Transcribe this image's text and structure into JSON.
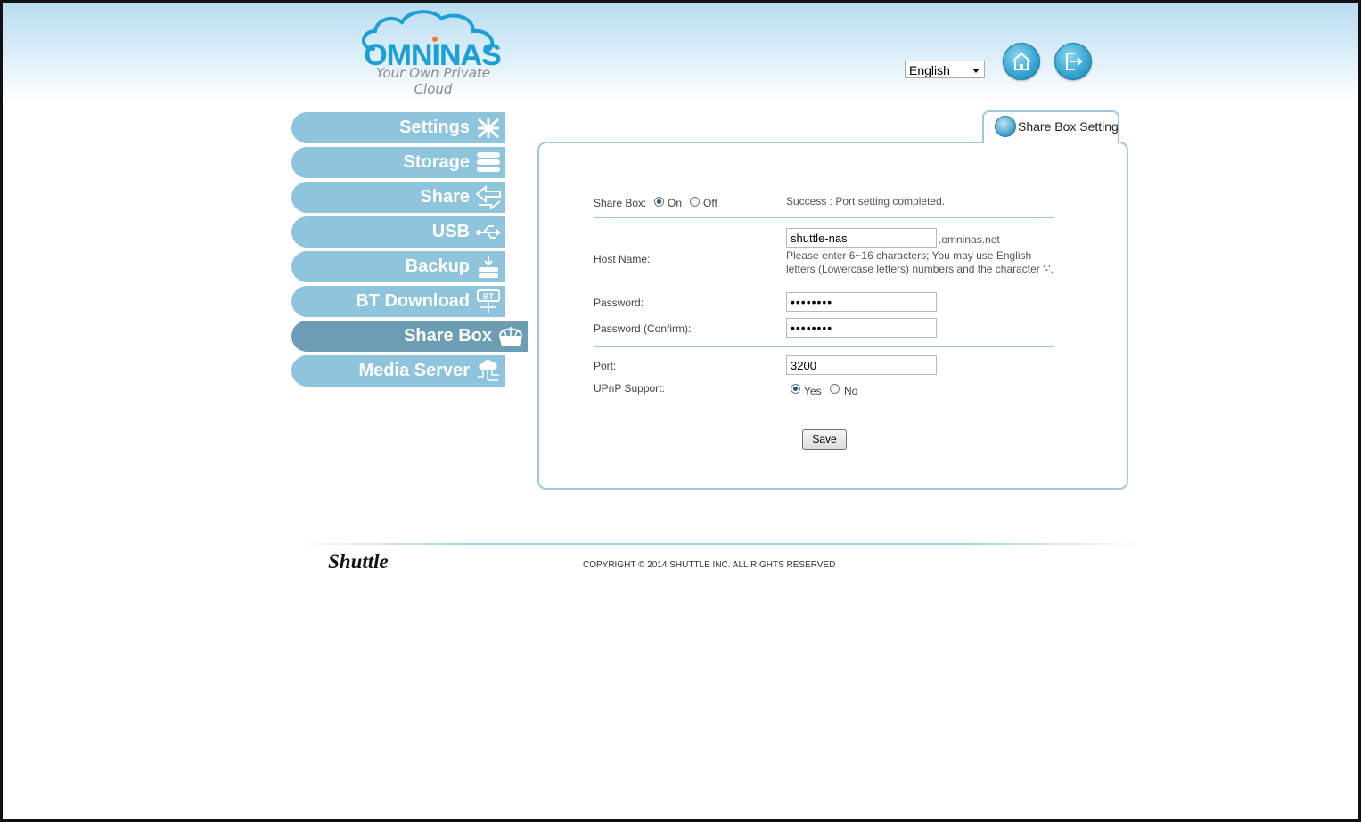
{
  "header": {
    "logo_word": "OMNINAS",
    "logo_tagline": "Your Own Private Cloud",
    "language": "English",
    "home_icon": "home-icon",
    "logout_icon": "logout-icon"
  },
  "sidebar": {
    "items": [
      {
        "label": "Settings",
        "icon": "settings-icon"
      },
      {
        "label": "Storage",
        "icon": "storage-icon"
      },
      {
        "label": "Share",
        "icon": "share-icon"
      },
      {
        "label": "USB",
        "icon": "usb-icon"
      },
      {
        "label": "Backup",
        "icon": "backup-icon"
      },
      {
        "label": "BT Download",
        "icon": "bt-download-icon"
      },
      {
        "label": "Share Box",
        "icon": "share-box-icon",
        "active": true
      },
      {
        "label": "Media Server",
        "icon": "media-server-icon"
      }
    ]
  },
  "panel": {
    "tab_label": "Share Box Setting",
    "share_box_label": "Share Box:",
    "share_box_on": "On",
    "share_box_off": "Off",
    "share_box_value": "On",
    "status_message": "Success : Port setting completed.",
    "host_name_label": "Host Name:",
    "host_name_value": "shuttle-nas",
    "host_suffix": ".omninas.net",
    "host_hint": "Please enter 6~16 characters; You may use English letters (Lowercase letters) numbers and the character '-'.",
    "password_label": "Password:",
    "password_value": "••••••••",
    "password_confirm_label": "Password (Confirm):",
    "password_confirm_value": "••••••••",
    "port_label": "Port:",
    "port_value": "3200",
    "upnp_label": "UPnP Support:",
    "upnp_yes": "Yes",
    "upnp_no": "No",
    "upnp_value": "Yes",
    "save_label": "Save"
  },
  "footer": {
    "brand": "Shuttle",
    "copyright": "COPYRIGHT © 2014 SHUTTLE INC. ALL RIGHTS RESERVED"
  },
  "colors": {
    "nav": "#8ec5dd",
    "nav_active": "#6c9db2",
    "accent": "#1c9fd6"
  }
}
